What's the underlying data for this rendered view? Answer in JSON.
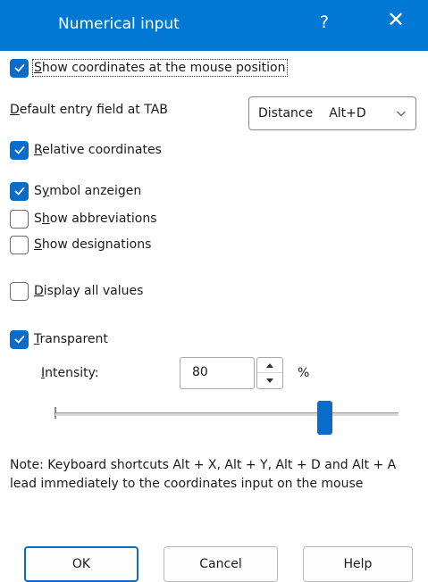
{
  "titlebar": {
    "title": "Numerical input",
    "help_glyph": "?",
    "close_glyph": "✕"
  },
  "options": {
    "show_coordinates": {
      "pre": "",
      "key": "S",
      "post": "how coordinates at the mouse position",
      "checked": true
    },
    "default_entry_label": {
      "pre": "",
      "key": "D",
      "post": "efault entry field at TAB"
    },
    "default_entry_value": {
      "field": "Distance",
      "shortcut": "Alt+D"
    },
    "relative_coordinates": {
      "pre": "",
      "key": "R",
      "post": "elative coordinates",
      "checked": true
    },
    "symbol_anzeigen": {
      "pre": "S",
      "key": "y",
      "post": "mbol anzeigen",
      "checked": true
    },
    "show_abbreviations": {
      "pre": "S",
      "key": "h",
      "post": "ow abbreviations",
      "checked": false
    },
    "show_designations": {
      "pre": "",
      "key": "S",
      "post": "how designations",
      "checked": false
    },
    "display_all_values": {
      "pre": "",
      "key": "D",
      "post": "isplay all values",
      "checked": false
    },
    "transparent": {
      "pre": "",
      "key": "T",
      "post": "ransparent",
      "checked": true
    }
  },
  "intensity": {
    "pre": "",
    "key": "I",
    "post": "ntensity:",
    "value": "80",
    "unit": "%",
    "slider_level": 0.8
  },
  "note": "Note: Keyboard shortcuts Alt + X, Alt + Y, Alt + D and Alt + A lead immediately to the coordinates input on the mouse",
  "buttons": {
    "ok": "OK",
    "cancel": "Cancel",
    "help": "Help"
  },
  "colors": {
    "accent": "#0078d4",
    "checkbox": "#0a6cc9"
  },
  "icons": {
    "check": "checkmark-icon",
    "close": "close-icon",
    "help": "help-icon",
    "dropdown": "chevron-down-icon",
    "spin_up": "triangle-up-icon",
    "spin_down": "triangle-down-icon"
  }
}
